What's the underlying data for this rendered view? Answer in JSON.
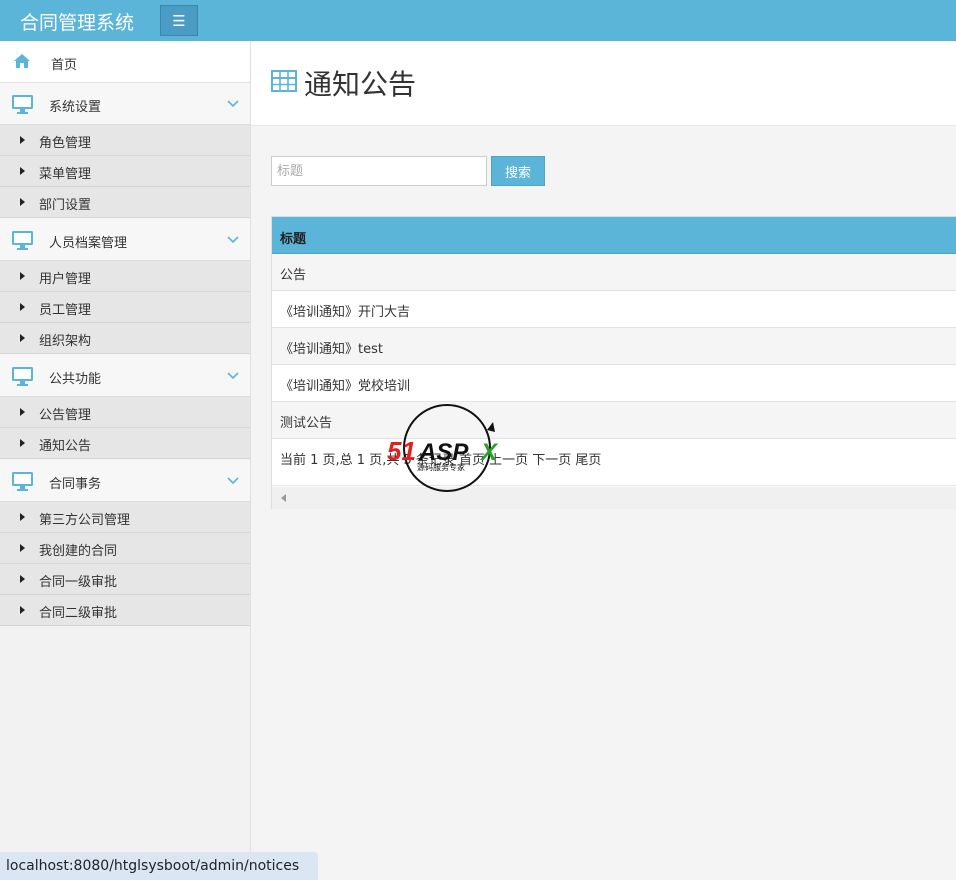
{
  "app": {
    "title": "合同管理系统"
  },
  "sidebar": {
    "home": {
      "label": "首页"
    },
    "groups": [
      {
        "label": "系统设置",
        "items": [
          {
            "label": "角色管理"
          },
          {
            "label": "菜单管理"
          },
          {
            "label": "部门设置"
          }
        ]
      },
      {
        "label": "人员档案管理",
        "items": [
          {
            "label": "用户管理"
          },
          {
            "label": "员工管理"
          },
          {
            "label": "组织架构"
          }
        ]
      },
      {
        "label": "公共功能",
        "items": [
          {
            "label": "公告管理"
          },
          {
            "label": "通知公告"
          }
        ]
      },
      {
        "label": "合同事务",
        "items": [
          {
            "label": "第三方公司管理"
          },
          {
            "label": "我创建的合同"
          },
          {
            "label": "合同一级审批"
          },
          {
            "label": "合同二级审批"
          }
        ]
      }
    ]
  },
  "page": {
    "title": "通知公告",
    "search": {
      "placeholder": "标题",
      "button_label": "搜索"
    },
    "table": {
      "header": "标题",
      "rows": [
        "公告",
        "《培训通知》开门大吉",
        "《培训通知》test",
        "《培训通知》党校培训",
        "测试公告"
      ]
    },
    "pager": "当前 1 页,总 1 页,共 5 条记录 首页 上一页 下一页 尾页"
  },
  "watermark": {
    "brand": "51Aspx",
    "tagline": "源码服务专家"
  },
  "status_bar": {
    "url": "localhost:8080/htglsysboot/admin/notices"
  },
  "colors": {
    "accent": "#5bb5d9",
    "sidebar_bg": "#f2f2f2",
    "submenu_bg": "#e6e6e6",
    "icon": "#5bb5d9"
  }
}
